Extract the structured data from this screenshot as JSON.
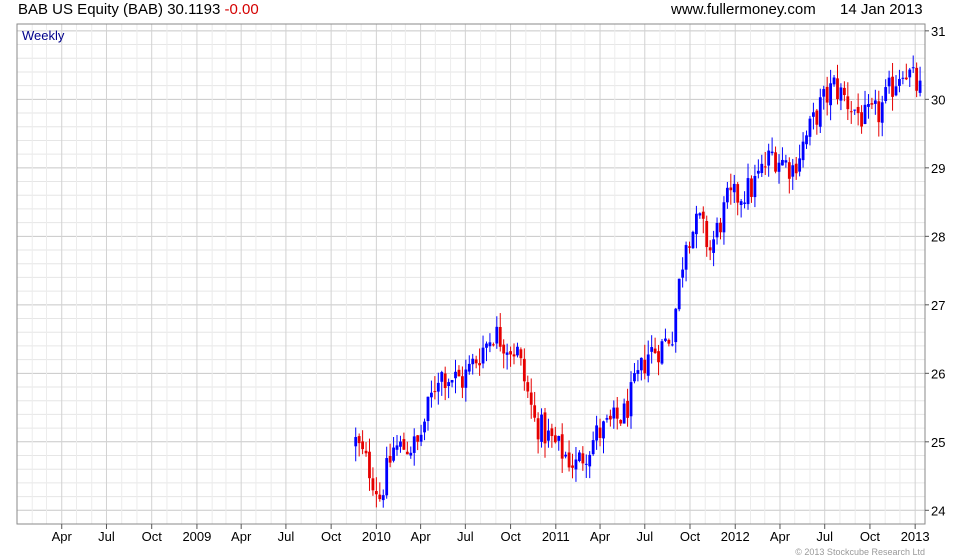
{
  "header": {
    "title": "BAB US Equity (BAB) 30.1193",
    "change": "-0.00",
    "site": "www.fullermoney.com",
    "date": "14 Jan 2013"
  },
  "footer": {
    "copyright": "© 2013 Stockcube Research Ltd"
  },
  "chart_data": {
    "type": "candlestick",
    "period_label": "Weekly",
    "title": "BAB US Equity (BAB) 30.1193 -0.00",
    "x_tick_labels": [
      "Apr",
      "Jul",
      "Oct",
      "2009",
      "Apr",
      "Jul",
      "Oct",
      "2010",
      "Apr",
      "Jul",
      "Oct",
      "2011",
      "Apr",
      "Jul",
      "Oct",
      "2012",
      "Apr",
      "Jul",
      "Oct",
      "2013"
    ],
    "x_range": [
      "2008-01",
      "2013-01"
    ],
    "y_tick_labels": [
      "24",
      "25",
      "26",
      "27",
      "28",
      "29",
      "30",
      "31"
    ],
    "ylim": [
      23.8,
      31.1
    ],
    "y_axis_side": "right",
    "grid": true,
    "colors": {
      "up": "#0000ff",
      "down": "#e60000",
      "grid": "#d9d9d9",
      "period_label": "#00008b",
      "change": "#d40000"
    },
    "weekly_close_keypoints": [
      [
        "2009-11-20",
        25.0
      ],
      [
        "2009-12-18",
        24.6
      ],
      [
        "2010-01-08",
        24.2
      ],
      [
        "2010-02-05",
        24.9
      ],
      [
        "2010-03-26",
        24.95
      ],
      [
        "2010-05-07",
        26.0
      ],
      [
        "2010-06-25",
        25.9
      ],
      [
        "2010-08-27",
        26.6
      ],
      [
        "2010-10-15",
        26.3
      ],
      [
        "2010-11-19",
        25.3
      ],
      [
        "2010-12-31",
        24.95
      ],
      [
        "2011-02-11",
        24.65
      ],
      [
        "2011-03-25",
        25.1
      ],
      [
        "2011-05-20",
        25.4
      ],
      [
        "2011-07-08",
        26.3
      ],
      [
        "2011-08-05",
        26.4
      ],
      [
        "2011-08-26",
        26.6
      ],
      [
        "2011-09-23",
        28.0
      ],
      [
        "2011-10-21",
        28.2
      ],
      [
        "2011-11-11",
        27.8
      ],
      [
        "2011-12-16",
        28.5
      ],
      [
        "2012-02-03",
        28.7
      ],
      [
        "2012-03-16",
        29.2
      ],
      [
        "2012-04-27",
        29.0
      ],
      [
        "2012-06-22",
        29.9
      ],
      [
        "2012-07-20",
        30.2
      ],
      [
        "2012-08-24",
        29.9
      ],
      [
        "2012-09-21",
        29.7
      ],
      [
        "2012-10-19",
        29.8
      ],
      [
        "2012-11-16",
        30.2
      ],
      [
        "2012-12-07",
        30.5
      ],
      [
        "2013-01-11",
        30.12
      ]
    ]
  }
}
